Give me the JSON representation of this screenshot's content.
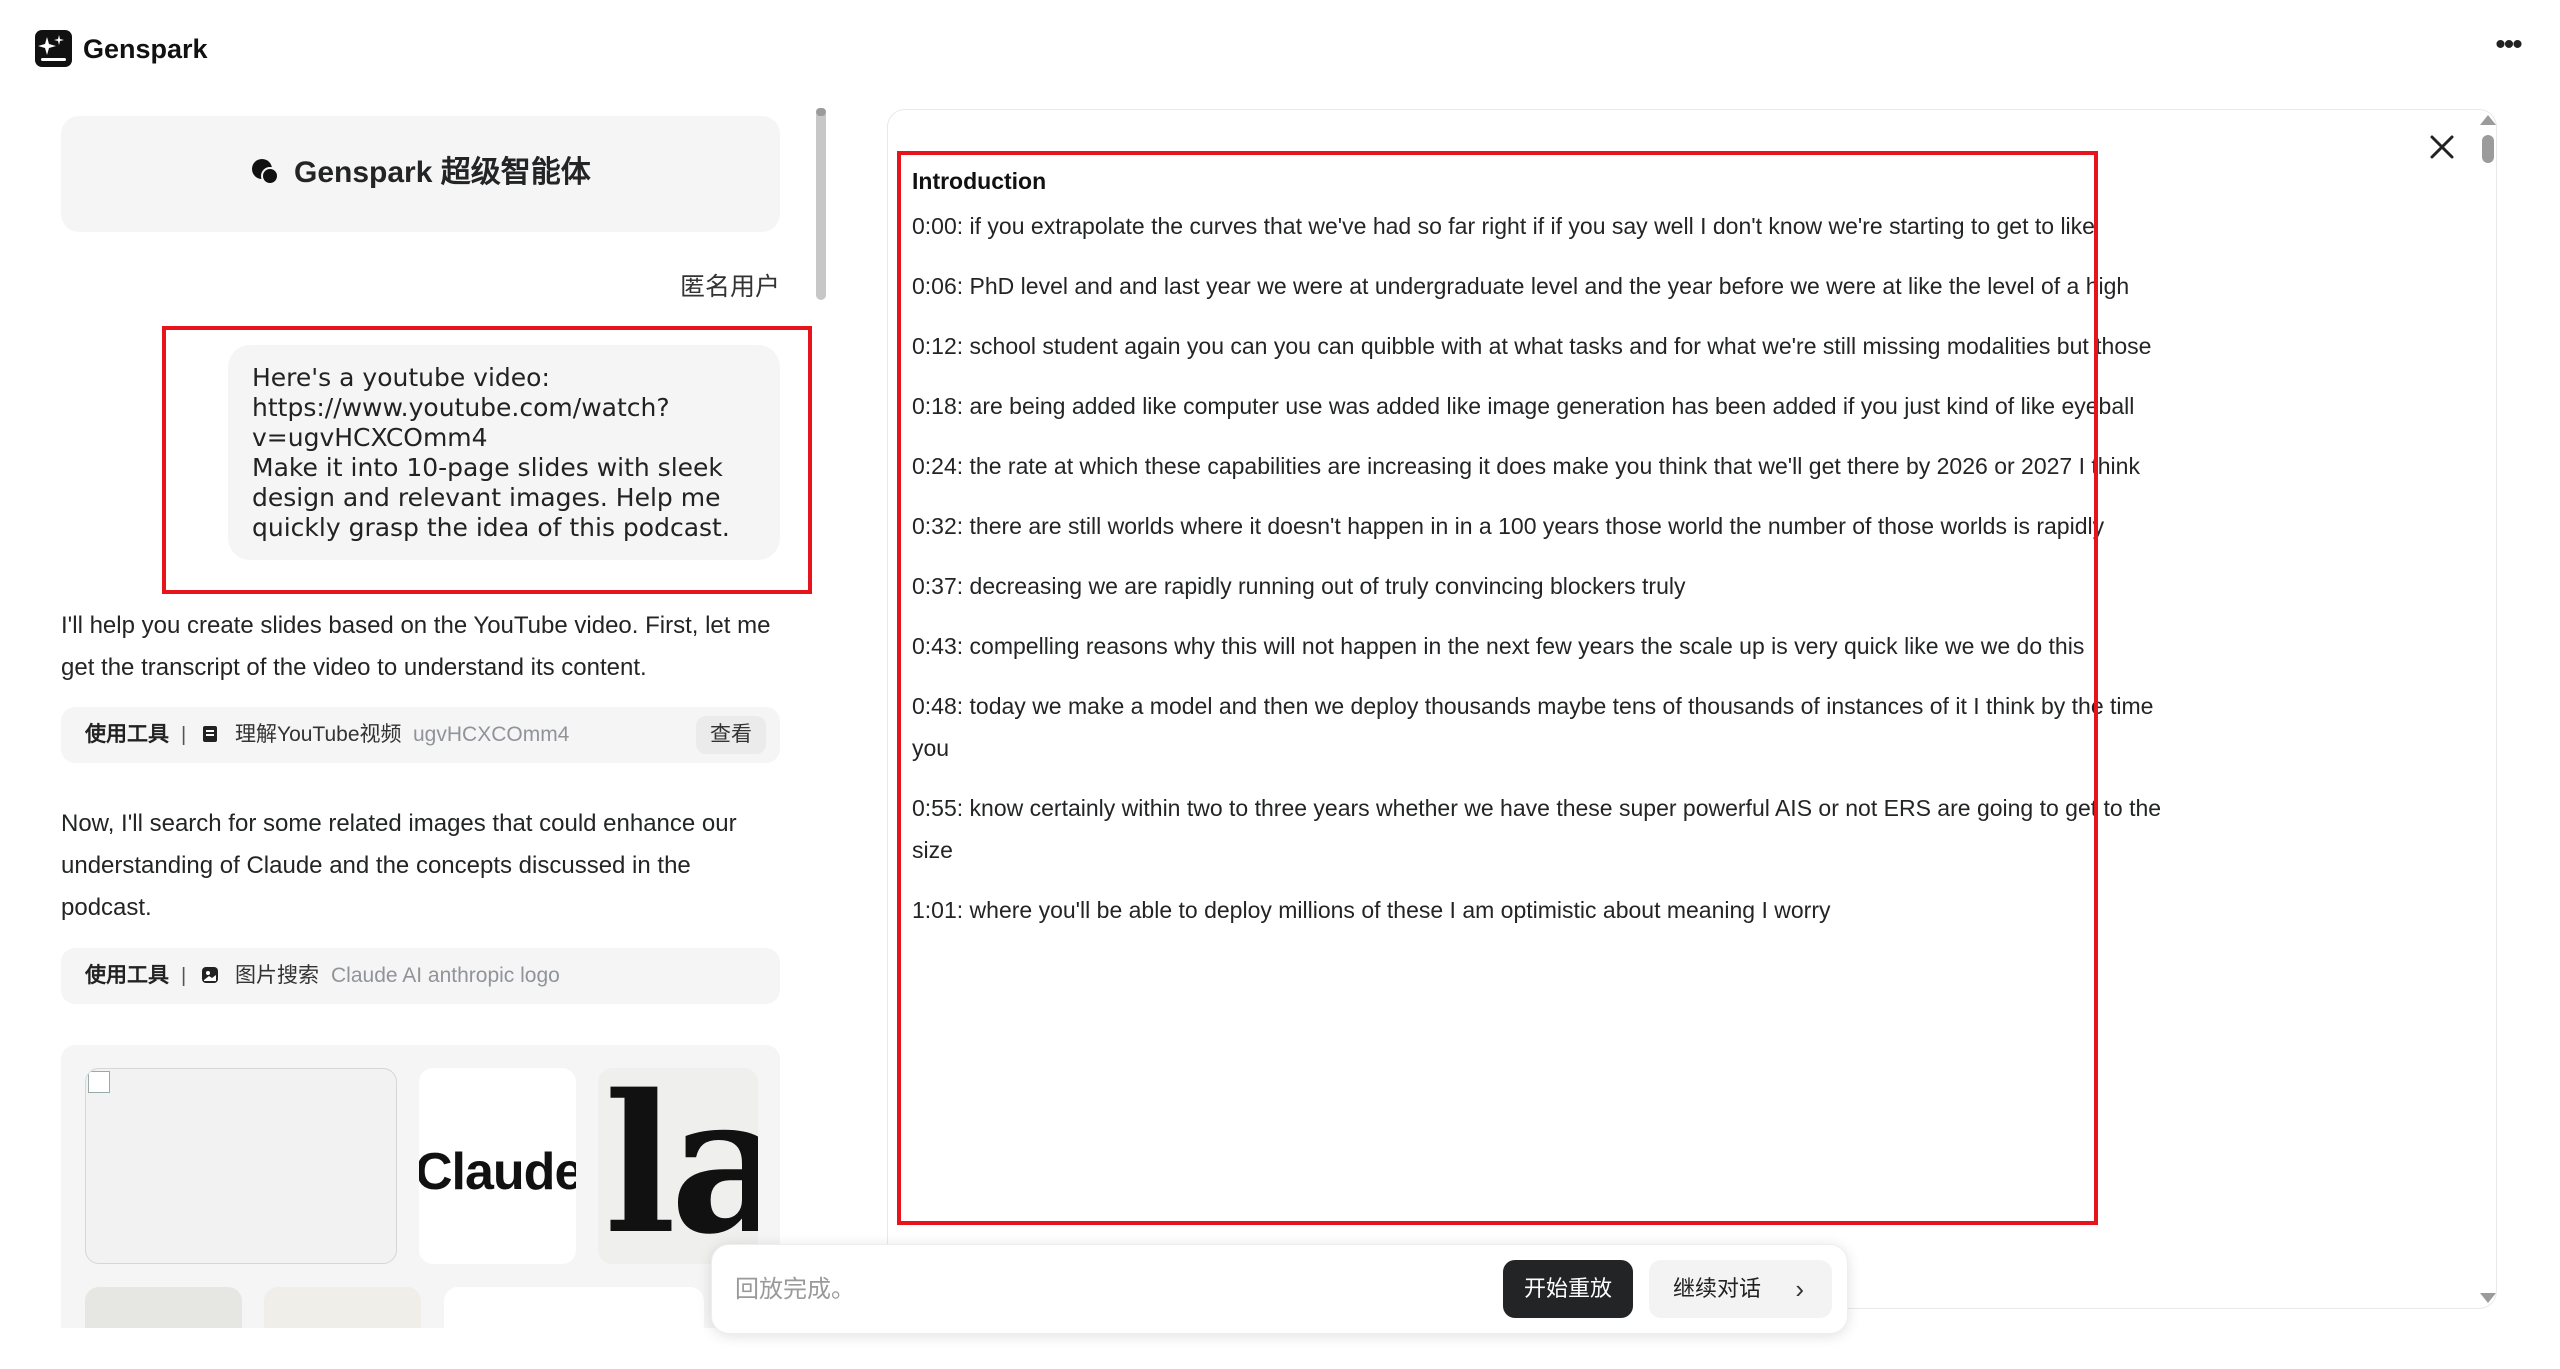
{
  "app": {
    "name": "Genspark"
  },
  "agent": {
    "title": "Genspark 超级智能体"
  },
  "chat": {
    "user_name": "匿名用户",
    "user_message_lines": [
      "Here's a youtube video:",
      "https://www.youtube.com/watch?",
      "v=ugvHCXCOmm4",
      "Make it into 10-page slides with sleek",
      "design and relevant images. Help me",
      "quickly grasp the idea of this podcast."
    ],
    "assistant_1": "I'll help you create slides based on the YouTube video. First, let me get the transcript of the video to understand its content.",
    "tool_1": {
      "label": "使用工具",
      "sep": "|",
      "name": "理解YouTube视频",
      "arg": "ugvHCXCOmm4",
      "view": "查看"
    },
    "assistant_2": "Now, I'll search for some related images that could enhance our understanding of Claude and the concepts discussed in the podcast.",
    "tool_2": {
      "label": "使用工具",
      "sep": "|",
      "name": "图片搜索",
      "arg": "Claude AI anthropic logo"
    },
    "images": {
      "claude_text": "Claude",
      "la_text": "la"
    }
  },
  "transcript": {
    "heading": "Introduction",
    "entries": [
      "0:00: if you extrapolate the curves that we've had so far right if if you say well I don't know we're starting to get to like",
      "0:06: PhD level and and last year we were at undergraduate level and the year before we were at like the level of a high",
      "0:12: school student again you can you can quibble with at what tasks and for what we're still missing modalities but those",
      "0:18: are being added like computer use was added like image generation has been added if you just kind of like eyeball",
      "0:24: the rate at which these capabilities are increasing it does make you think that we'll get there by 2026 or 2027 I think",
      "0:32: there are still worlds where it doesn't happen in in a 100 years those world the number of those worlds is rapidly",
      "0:37: decreasing we are rapidly running out of truly convincing blockers truly",
      "0:43: compelling reasons why this will not happen in the next few years the scale up is very quick like we we do this",
      "0:48: today we make a model and then we deploy thousands maybe tens of thousands of instances of it I think by the time you",
      "0:55: know certainly within two to three years whether we have these super powerful AIS or not ERS are going to get to the size",
      "1:01: where you'll be able to deploy millions of these I am optimistic about meaning I worry"
    ]
  },
  "replay": {
    "status": "回放完成。",
    "start_label": "开始重放",
    "continue_label": "继续对话",
    "continue_chevron": "›"
  },
  "colors": {
    "highlight": "#e8141b",
    "dark_button": "#232425"
  }
}
